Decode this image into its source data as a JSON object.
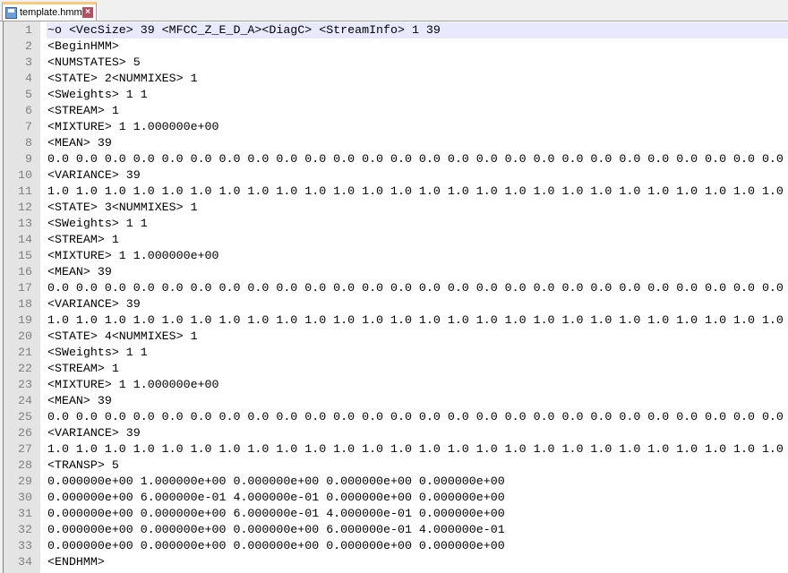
{
  "tab": {
    "title": "template.hmm",
    "icon": "save-icon",
    "close_icon": "close-icon"
  },
  "current_line": 1,
  "lines": [
    "~o <VecSize> 39 <MFCC_Z_E_D_A><DiagC> <StreamInfo> 1 39",
    "<BeginHMM>",
    "<NUMSTATES> 5",
    "<STATE> 2<NUMMIXES> 1",
    "<SWeights> 1 1",
    "<STREAM> 1",
    "<MIXTURE> 1 1.000000e+00",
    "<MEAN> 39",
    "0.0 0.0 0.0 0.0 0.0 0.0 0.0 0.0 0.0 0.0 0.0 0.0 0.0 0.0 0.0 0.0 0.0 0.0 0.0 0.0 0.0 0.0 0.0 0.0 0.0 0.0",
    "<VARIANCE> 39",
    "1.0 1.0 1.0 1.0 1.0 1.0 1.0 1.0 1.0 1.0 1.0 1.0 1.0 1.0 1.0 1.0 1.0 1.0 1.0 1.0 1.0 1.0 1.0 1.0 1.0 1.0",
    "<STATE> 3<NUMMIXES> 1",
    "<SWeights> 1 1",
    "<STREAM> 1",
    "<MIXTURE> 1 1.000000e+00",
    "<MEAN> 39",
    "0.0 0.0 0.0 0.0 0.0 0.0 0.0 0.0 0.0 0.0 0.0 0.0 0.0 0.0 0.0 0.0 0.0 0.0 0.0 0.0 0.0 0.0 0.0 0.0 0.0 0.0",
    "<VARIANCE> 39",
    "1.0 1.0 1.0 1.0 1.0 1.0 1.0 1.0 1.0 1.0 1.0 1.0 1.0 1.0 1.0 1.0 1.0 1.0 1.0 1.0 1.0 1.0 1.0 1.0 1.0 1.0",
    "<STATE> 4<NUMMIXES> 1",
    "<SWeights> 1 1",
    "<STREAM> 1",
    "<MIXTURE> 1 1.000000e+00",
    "<MEAN> 39",
    "0.0 0.0 0.0 0.0 0.0 0.0 0.0 0.0 0.0 0.0 0.0 0.0 0.0 0.0 0.0 0.0 0.0 0.0 0.0 0.0 0.0 0.0 0.0 0.0 0.0 0.0",
    "<VARIANCE> 39",
    "1.0 1.0 1.0 1.0 1.0 1.0 1.0 1.0 1.0 1.0 1.0 1.0 1.0 1.0 1.0 1.0 1.0 1.0 1.0 1.0 1.0 1.0 1.0 1.0 1.0 1.0",
    "<TRANSP> 5",
    "0.000000e+00 1.000000e+00 0.000000e+00 0.000000e+00 0.000000e+00",
    "0.000000e+00 6.000000e-01 4.000000e-01 0.000000e+00 0.000000e+00",
    "0.000000e+00 0.000000e+00 6.000000e-01 4.000000e-01 0.000000e+00",
    "0.000000e+00 0.000000e+00 0.000000e+00 6.000000e-01 4.000000e-01",
    "0.000000e+00 0.000000e+00 0.000000e+00 0.000000e+00 0.000000e+00",
    "<ENDHMM>"
  ],
  "line_numbers": [
    "1",
    "2",
    "3",
    "4",
    "5",
    "6",
    "7",
    "8",
    "9",
    "10",
    "11",
    "12",
    "13",
    "14",
    "15",
    "16",
    "17",
    "18",
    "19",
    "20",
    "21",
    "22",
    "23",
    "24",
    "25",
    "26",
    "27",
    "28",
    "29",
    "30",
    "31",
    "32",
    "33",
    "34"
  ],
  "colors": {
    "current_line": "#e8e8ff",
    "gutter": "#e4e4e4",
    "line_number": "#808080",
    "tab_accent": "#fac87d"
  }
}
